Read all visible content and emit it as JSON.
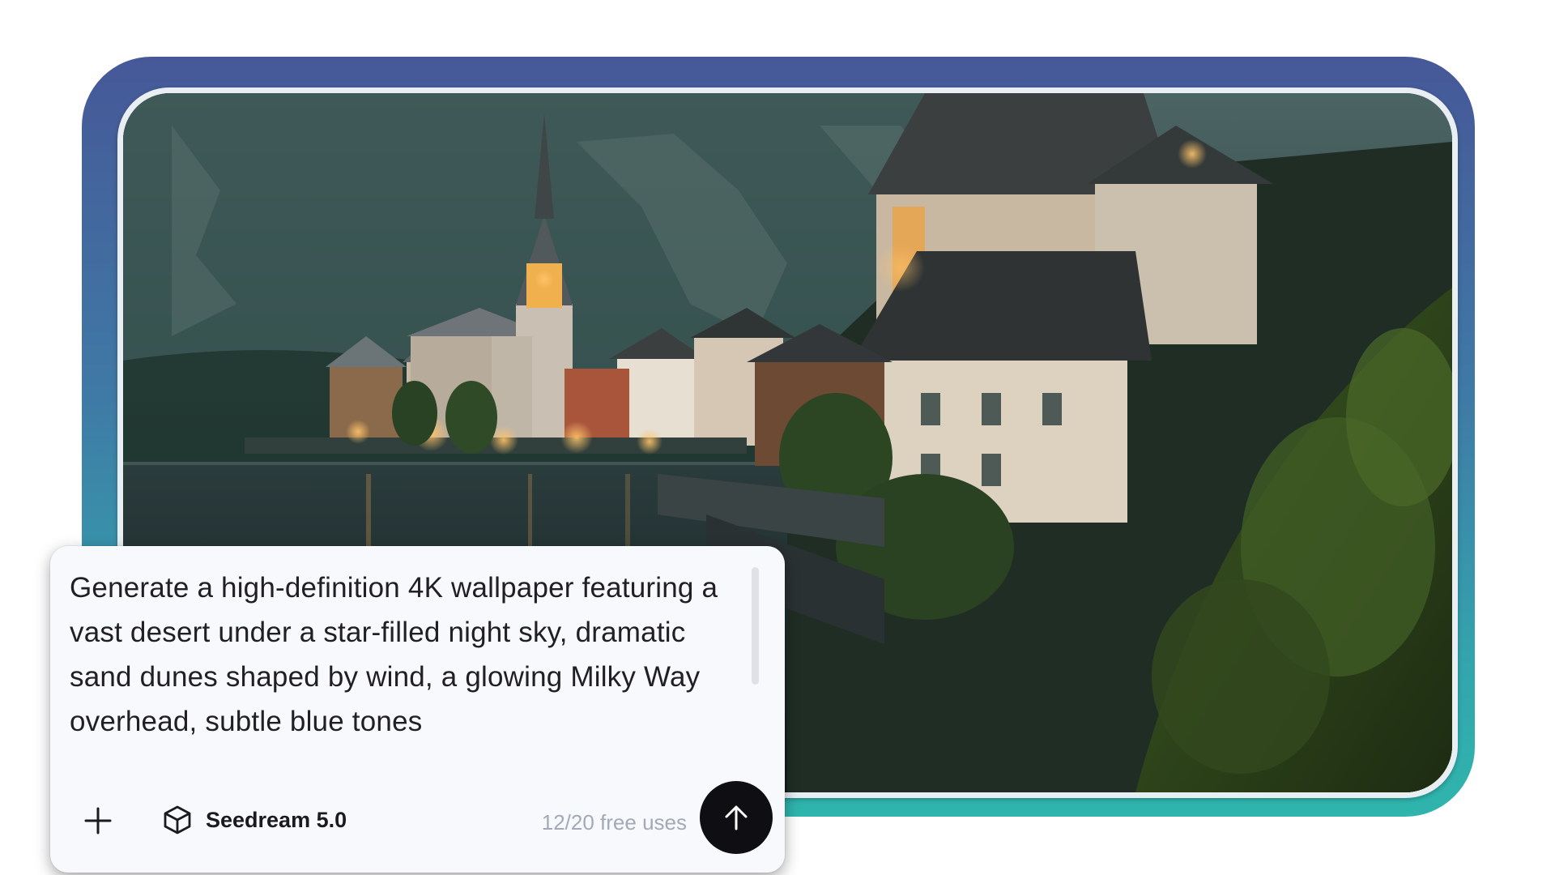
{
  "prompt": {
    "text": "Generate a high-definition 4K wallpaper featuring a vast desert under a star-filled night sky, dramatic sand dunes shaped by wind, a glowing Milky Way overhead, subtle blue tones"
  },
  "toolbar": {
    "add_icon": "plus-icon",
    "model_icon": "cube-icon",
    "model_label": "Seedream 5.0",
    "usage_text": "12/20 free uses",
    "send_icon": "arrow-up-icon"
  },
  "colors": {
    "frame_top": "#465898",
    "frame_bottom": "#2fb5ad",
    "card_background": "#f8f9fc",
    "send_button": "#0f0f13",
    "usage_text": "#a3a9b6"
  }
}
